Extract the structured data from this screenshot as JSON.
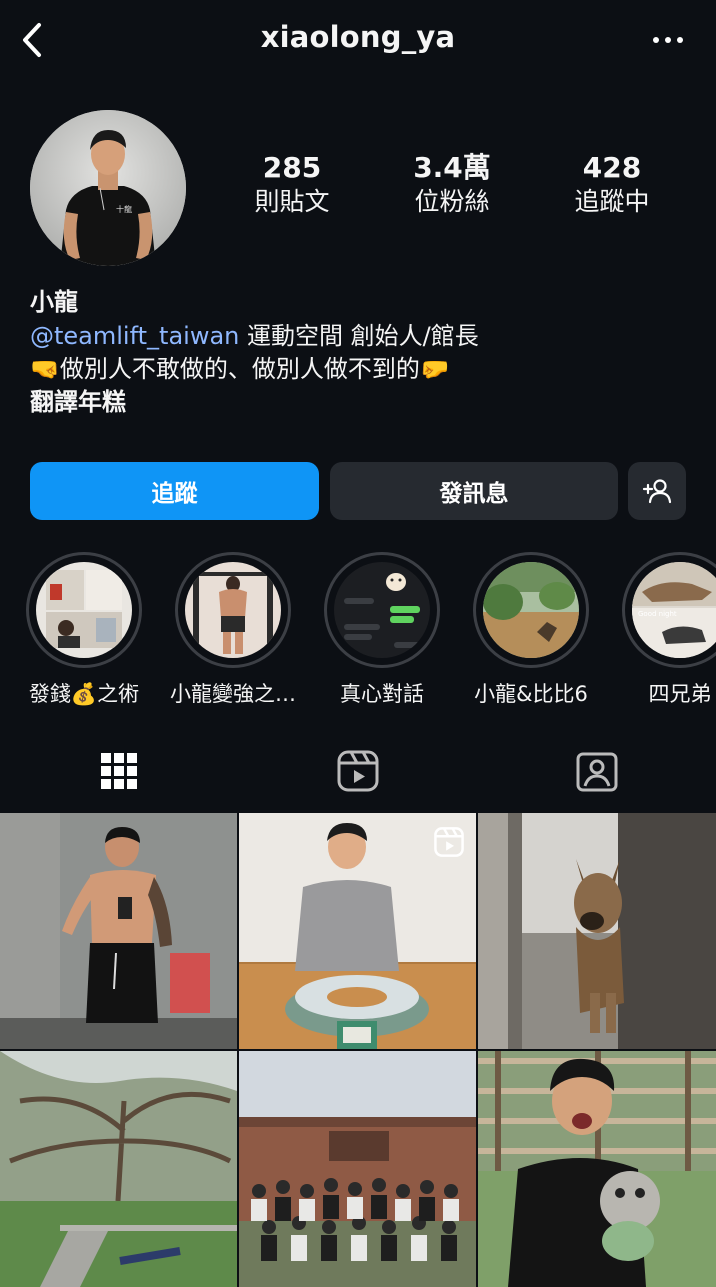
{
  "header": {
    "username": "xiaolong_ya",
    "back_icon": "chevron-left-icon",
    "more_icon": "more-horizontal-icon"
  },
  "stats": [
    {
      "value": "285",
      "label": "則貼文"
    },
    {
      "value": "3.4萬",
      "label": "位粉絲"
    },
    {
      "value": "428",
      "label": "追蹤中"
    }
  ],
  "bio": {
    "name": "小龍",
    "mention": "@teamlift_taiwan",
    "line1_rest": " 運動空間 創始人/館長",
    "line2": "🤜做別人不敢做的、做別人做不到的🤛",
    "line3": "翻譯年糕"
  },
  "buttons": {
    "follow": "追蹤",
    "message": "發訊息",
    "add_user_icon": "add-person-icon"
  },
  "highlights": [
    {
      "label": "發錢💰之術"
    },
    {
      "label": "小龍變強之…"
    },
    {
      "label": "真心對話"
    },
    {
      "label": "小龍&比比6"
    },
    {
      "label": "四兄弟"
    }
  ],
  "tabs": [
    "grid-icon",
    "reels-icon",
    "tagged-icon"
  ],
  "colors": {
    "background": "#0c0f14",
    "follow_button": "#0f95f6",
    "secondary_button": "#262a30",
    "mention": "#8fb8ff"
  }
}
